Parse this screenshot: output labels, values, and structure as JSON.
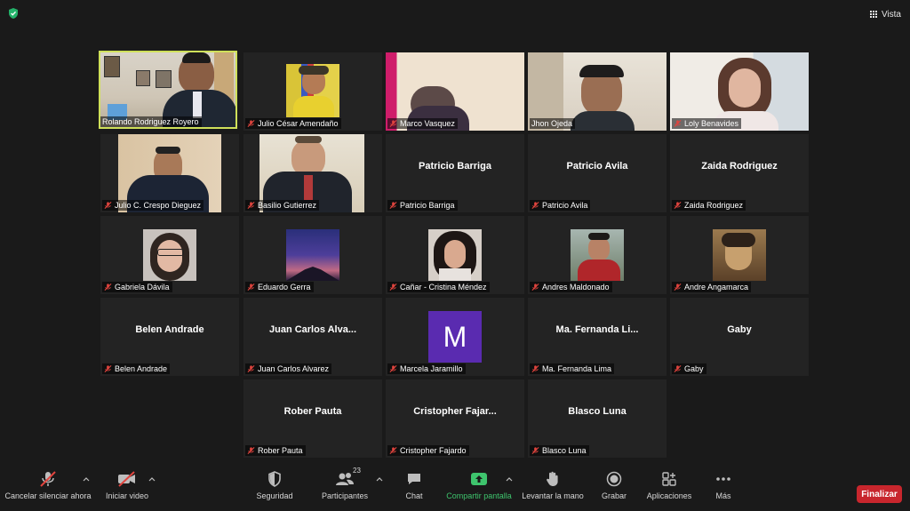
{
  "topbar": {
    "view_label": "Vista"
  },
  "tiles": [
    {
      "name": "Rolando Rodriguez Royero",
      "center": ""
    },
    {
      "name": "Julio César Amendaño",
      "center": ""
    },
    {
      "name": "Marco Vasquez",
      "center": ""
    },
    {
      "name": "Jhon Ojeda",
      "center": ""
    },
    {
      "name": "Loly Benavides",
      "center": ""
    },
    {
      "name": "Julio C. Crespo Dieguez",
      "center": ""
    },
    {
      "name": "Basilio Gutierrez",
      "center": ""
    },
    {
      "name": "Patricio Barriga",
      "center": "Patricio Barriga"
    },
    {
      "name": "Patricio Avila",
      "center": "Patricio Avila"
    },
    {
      "name": "Zaida Rodriguez",
      "center": "Zaida Rodriguez"
    },
    {
      "name": "Gabriela Dávila",
      "center": ""
    },
    {
      "name": "Eduardo Gerra",
      "center": ""
    },
    {
      "name": "Cañar - Cristina Méndez",
      "center": ""
    },
    {
      "name": "Andres Maldonado",
      "center": ""
    },
    {
      "name": "Andre Angamarca",
      "center": ""
    },
    {
      "name": "Belen Andrade",
      "center": "Belen Andrade"
    },
    {
      "name": "Juan Carlos Alvarez",
      "center": "Juan Carlos Alva..."
    },
    {
      "name": "Marcela Jaramillo",
      "center": "",
      "initial": "M"
    },
    {
      "name": "Ma. Fernanda Lima",
      "center": "Ma. Fernanda Li..."
    },
    {
      "name": "Gaby",
      "center": "Gaby"
    },
    {
      "name": "Rober Pauta",
      "center": "Rober Pauta"
    },
    {
      "name": "Cristopher Fajardo",
      "center": "Cristopher Fajar..."
    },
    {
      "name": "Blasco Luna",
      "center": "Blasco Luna"
    }
  ],
  "toolbar": {
    "mute_label": "Cancelar silenciar ahora",
    "video_label": "Iniciar video",
    "security_label": "Seguridad",
    "participants_label": "Participantes",
    "participants_count": "23",
    "chat_label": "Chat",
    "share_label": "Compartir pantalla",
    "raise_hand_label": "Levantar la mano",
    "record_label": "Grabar",
    "apps_label": "Aplicaciones",
    "more_label": "Más",
    "end_label": "Finalizar"
  },
  "colors": {
    "active_speaker": "#cfe05a",
    "end_button": "#c8262d",
    "share_green": "#3ec46d",
    "avatar_purple": "#5a2bb0",
    "mic_off_red": "#e0443e"
  }
}
